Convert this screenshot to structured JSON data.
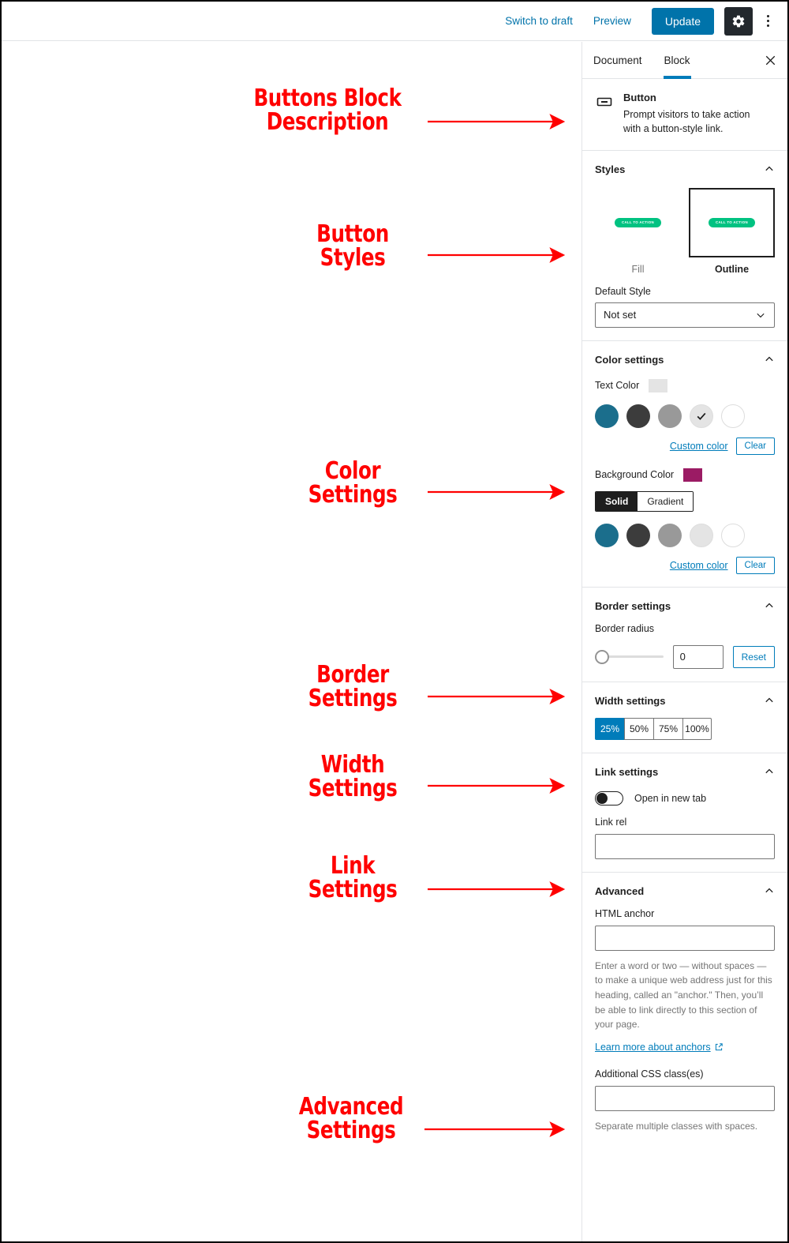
{
  "toolbar": {
    "switch_to_draft": "Switch to draft",
    "preview": "Preview",
    "update": "Update",
    "settings_icon": "gear-icon",
    "more_icon": "kebab-menu-icon"
  },
  "sidebar": {
    "tabs": [
      {
        "label": "Document",
        "active": false
      },
      {
        "label": "Block",
        "active": true
      }
    ],
    "close_icon": "close-icon",
    "block": {
      "icon": "button-block-icon",
      "title": "Button",
      "description": "Prompt visitors to take action with a button-style link."
    },
    "styles": {
      "title": "Styles",
      "items": [
        {
          "label": "Fill",
          "selected": false,
          "preview_text": "CALL TO ACTION"
        },
        {
          "label": "Outline",
          "selected": true,
          "preview_text": "CALL TO ACTION"
        }
      ],
      "preview_color": "#00c281",
      "default_style_label": "Default Style",
      "default_style_value": "Not set"
    },
    "color_settings": {
      "title": "Color settings",
      "text_color_label": "Text Color",
      "text_color_value": "#e4e4e4",
      "text_swatches": [
        {
          "color": "#1b6e8c",
          "selected": false
        },
        {
          "color": "#3c3c3c",
          "selected": false
        },
        {
          "color": "#999999",
          "selected": false
        },
        {
          "color": "#e4e4e4",
          "selected": true
        },
        {
          "color": "#ffffff",
          "selected": false
        }
      ],
      "background_color_label": "Background Color",
      "background_color_value": "#9b1b64",
      "bg_mode": [
        {
          "label": "Solid",
          "on": true
        },
        {
          "label": "Gradient",
          "on": false
        }
      ],
      "bg_swatches": [
        {
          "color": "#1b6e8c",
          "selected": false
        },
        {
          "color": "#3c3c3c",
          "selected": false
        },
        {
          "color": "#999999",
          "selected": false
        },
        {
          "color": "#e4e4e4",
          "selected": false
        },
        {
          "color": "#ffffff",
          "selected": false
        }
      ],
      "custom_color": "Custom color",
      "clear": "Clear"
    },
    "border_settings": {
      "title": "Border settings",
      "radius_label": "Border radius",
      "radius_value": "0",
      "reset": "Reset"
    },
    "width_settings": {
      "title": "Width settings",
      "options": [
        {
          "label": "25%",
          "on": true
        },
        {
          "label": "50%",
          "on": false
        },
        {
          "label": "75%",
          "on": false
        },
        {
          "label": "100%",
          "on": false
        }
      ]
    },
    "link_settings": {
      "title": "Link settings",
      "open_new_tab_label": "Open in new tab",
      "open_new_tab_on": false,
      "link_rel_label": "Link rel",
      "link_rel_value": ""
    },
    "advanced": {
      "title": "Advanced",
      "html_anchor_label": "HTML anchor",
      "html_anchor_value": "",
      "html_anchor_help": "Enter a word or two — without spaces — to make a unique web address just for this heading, called an \"anchor.\" Then, you’ll be able to link directly to this section of your page.",
      "learn_more": "Learn more about anchors",
      "css_class_label": "Additional CSS class(es)",
      "css_class_value": "",
      "css_class_help": "Separate multiple classes with spaces."
    }
  },
  "annotations": {
    "color": "#ff0000",
    "items": [
      {
        "text": "Buttons Block\nDescription"
      },
      {
        "text": "Button\nStyles"
      },
      {
        "text": "Color\nSettings"
      },
      {
        "text": "Border\nSettings"
      },
      {
        "text": "Width\nSettings"
      },
      {
        "text": "Link\nSettings"
      },
      {
        "text": "Advanced\nSettings"
      }
    ]
  }
}
